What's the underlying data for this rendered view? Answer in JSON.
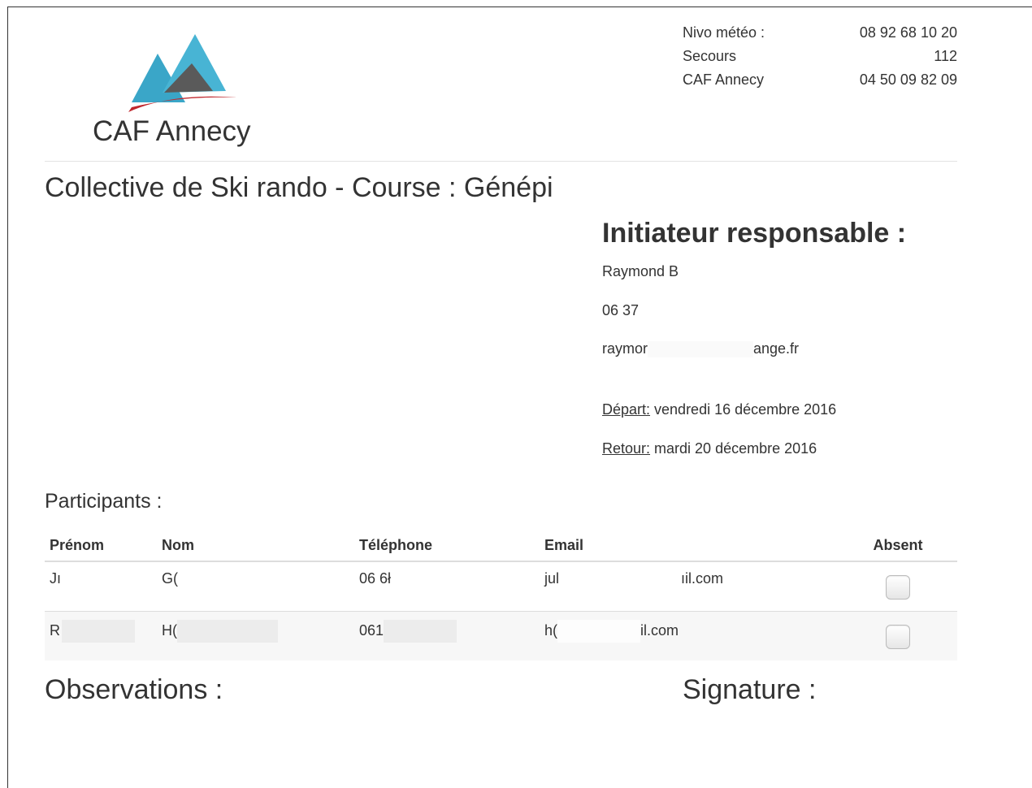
{
  "header": {
    "logo_text": "CAF Annecy",
    "brand_colors": {
      "peak_blue": "#3aa6c8",
      "peak_grey": "#5a5a5a",
      "swoosh_red": "#c0272d"
    },
    "contacts": [
      {
        "label": "Nivo météo :",
        "value": "08 92 68 10 20"
      },
      {
        "label": "Secours",
        "value": "112"
      },
      {
        "label": "CAF Annecy",
        "value": "04 50 09 82 09"
      }
    ]
  },
  "page_title": "Collective de Ski rando - Course : Génépi",
  "leader": {
    "heading": "Initiateur responsable :",
    "name": "Raymond B",
    "phone": "06 37",
    "email_start": "raymor",
    "email_end": "ange.fr"
  },
  "dates": {
    "departure_label": "Départ:",
    "departure_value": " vendredi 16 décembre 2016",
    "return_label": "Retour:",
    "return_value": " mardi 20 décembre 2016"
  },
  "participants": {
    "title": "Participants :",
    "columns": [
      "Prénom",
      "Nom",
      "Téléphone",
      "Email",
      "Absent"
    ],
    "rows": [
      {
        "prenom": "Jı",
        "nom": "G(",
        "telephone": "06 6ł",
        "email_start": "jul",
        "email_end": "ıil.com",
        "absent": false
      },
      {
        "prenom": "R",
        "nom": "H(",
        "telephone": "061",
        "email_start": "h(",
        "email_end": "il.com",
        "absent": false
      }
    ]
  },
  "observations_label": "Observations :",
  "signature_label": "Signature :"
}
